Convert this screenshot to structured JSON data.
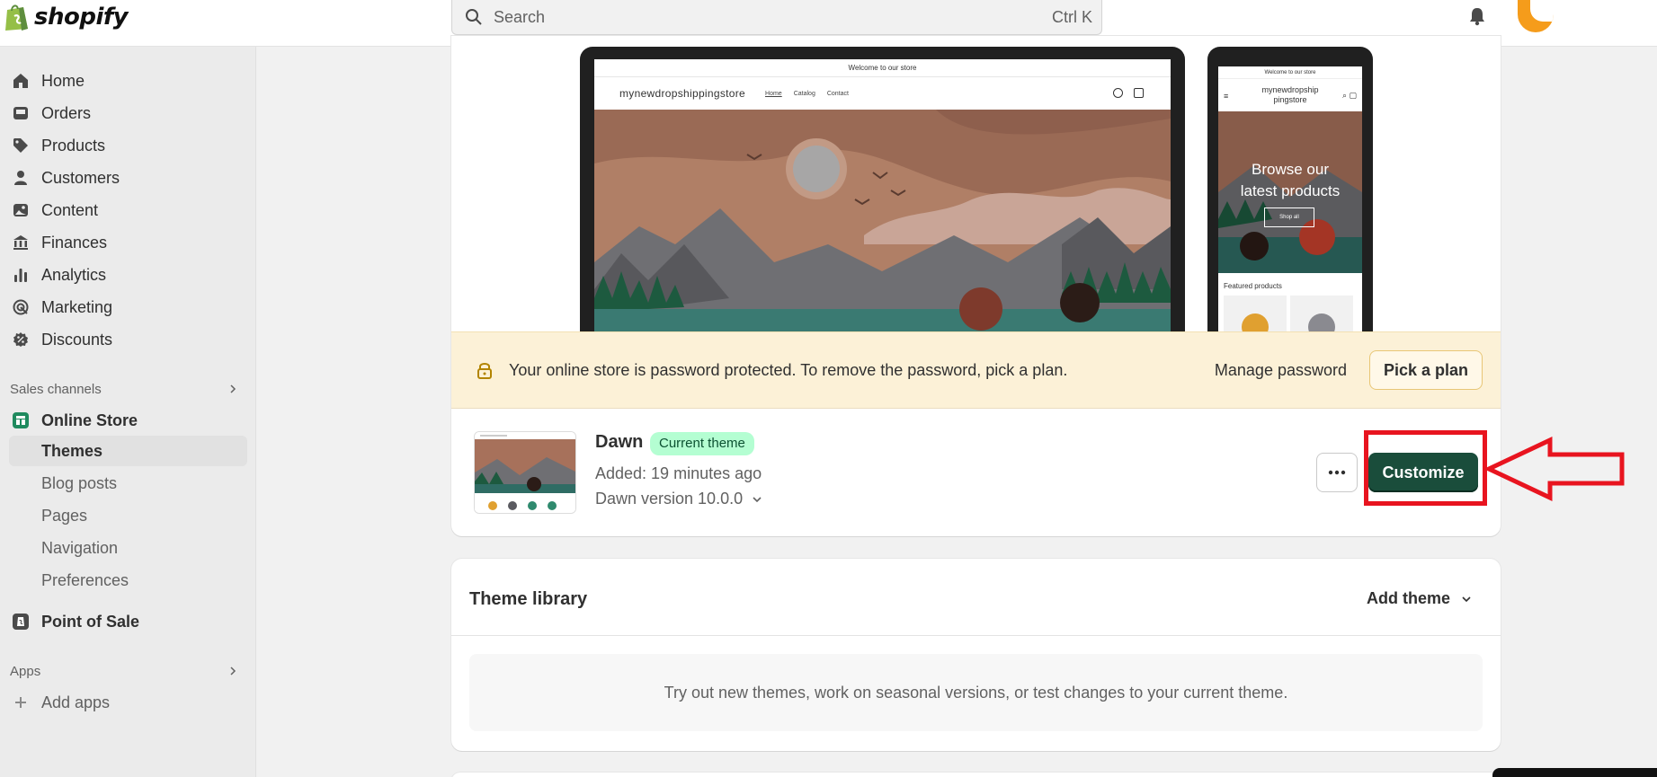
{
  "topbar": {
    "logo_text": "shopify",
    "search_placeholder": "Search",
    "search_shortcut": "Ctrl K"
  },
  "sidebar": {
    "main_items": [
      {
        "label": "Home",
        "icon": "home-icon"
      },
      {
        "label": "Orders",
        "icon": "inbox-icon"
      },
      {
        "label": "Products",
        "icon": "tag-icon"
      },
      {
        "label": "Customers",
        "icon": "person-icon"
      },
      {
        "label": "Content",
        "icon": "image-icon"
      },
      {
        "label": "Finances",
        "icon": "bank-icon"
      },
      {
        "label": "Analytics",
        "icon": "bar-chart-icon"
      },
      {
        "label": "Marketing",
        "icon": "target-icon"
      },
      {
        "label": "Discounts",
        "icon": "discount-icon"
      }
    ],
    "sales_channels_label": "Sales channels",
    "online_store": "Online Store",
    "online_store_subitems": [
      "Themes",
      "Blog posts",
      "Pages",
      "Navigation",
      "Preferences"
    ],
    "point_of_sale": "Point of Sale",
    "apps_label": "Apps",
    "add_apps": "Add apps"
  },
  "preview": {
    "desktop_announcement": "Welcome to our store",
    "desktop_store_name": "mynewdropshippingstore",
    "desktop_nav": [
      "Home",
      "Catalog",
      "Contact"
    ],
    "mobile_announcement": "Welcome to our store",
    "mobile_store_name_line1": "mynewdropship",
    "mobile_store_name_line2": "pingstore",
    "mobile_hero_line1": "Browse our",
    "mobile_hero_line2": "latest products",
    "mobile_shop_all": "Shop all",
    "mobile_featured": "Featured products"
  },
  "banner": {
    "message": "Your online store is password protected. To remove the password, pick a plan.",
    "manage_password": "Manage password",
    "pick_plan": "Pick a plan"
  },
  "current_theme": {
    "name": "Dawn",
    "badge": "Current theme",
    "added": "Added: 19 minutes ago",
    "version": "Dawn version 10.0.0",
    "customize": "Customize"
  },
  "library": {
    "title": "Theme library",
    "add_theme": "Add theme",
    "empty_text": "Try out new themes, work on seasonal versions, or test changes to your current theme."
  },
  "colors": {
    "brand_green": "#1a4d3b",
    "badge_bg": "#b4fed2",
    "banner_bg": "#fcf1d7",
    "annotation_red": "#e8141f"
  }
}
